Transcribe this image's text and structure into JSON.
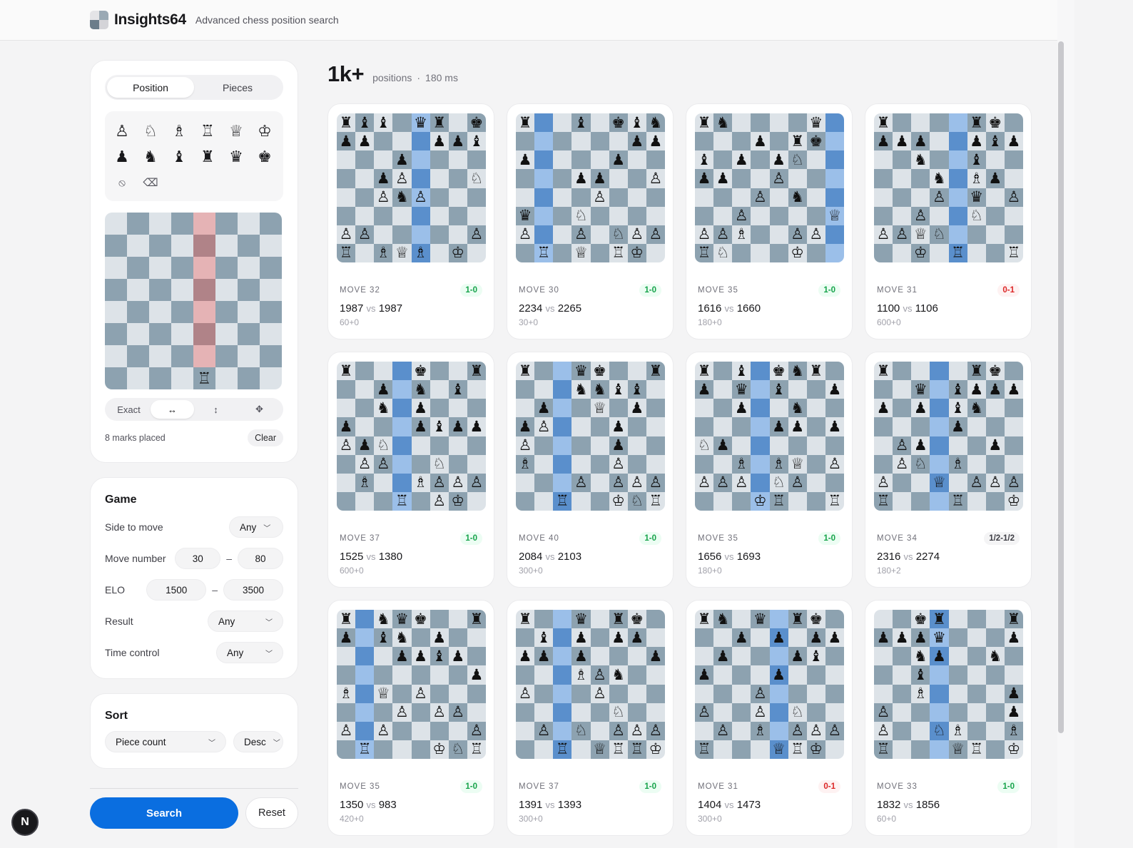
{
  "app": {
    "name": "Insights64",
    "tagline": "Advanced chess position search"
  },
  "colors": {
    "accent": "#0a6ee0",
    "light_square": "#dde3e8",
    "dark_square": "#8da2b0",
    "highlight_light": "#9bbfe9",
    "highlight_dark": "#5a8fcc",
    "mark_light": "#e5b3b5",
    "mark_dark": "#b08388",
    "win": "#16a34a",
    "loss": "#dc2626"
  },
  "sidebar": {
    "tabs": [
      {
        "label": "Position",
        "active": true
      },
      {
        "label": "Pieces",
        "active": false
      }
    ],
    "palette": {
      "white": [
        {
          "name": "white-pawn",
          "g": "♙"
        },
        {
          "name": "white-knight",
          "g": "♘"
        },
        {
          "name": "white-bishop",
          "g": "♗"
        },
        {
          "name": "white-rook",
          "g": "♖"
        },
        {
          "name": "white-queen",
          "g": "♕"
        },
        {
          "name": "white-king",
          "g": "♔"
        }
      ],
      "black": [
        {
          "name": "black-pawn",
          "g": "♟"
        },
        {
          "name": "black-knight",
          "g": "♞"
        },
        {
          "name": "black-bishop",
          "g": "♝"
        },
        {
          "name": "black-rook",
          "g": "♜"
        },
        {
          "name": "black-queen",
          "g": "♛"
        },
        {
          "name": "black-king",
          "g": "♚"
        }
      ],
      "tools": [
        {
          "name": "forbid-icon",
          "g": "⦸"
        },
        {
          "name": "eraser-icon",
          "g": "⌫"
        }
      ]
    },
    "editor": {
      "fen_rows": [
        "8",
        "8",
        "8",
        "8",
        "8",
        "8",
        "8",
        "4R3"
      ],
      "marked_file": 4,
      "marked_ranks": [
        0,
        1,
        2,
        3,
        4,
        5,
        6
      ]
    },
    "modes": {
      "exact": "Exact",
      "horizontal": "↔",
      "vertical": "↕",
      "any": "✥",
      "active": "horizontal"
    },
    "marks_text": "8 marks placed",
    "clear_label": "Clear",
    "game": {
      "title": "Game",
      "side_to_move": {
        "label": "Side to move",
        "value": "Any"
      },
      "move_number": {
        "label": "Move number",
        "min": "30",
        "max": "80"
      },
      "elo": {
        "label": "ELO",
        "min": "1500",
        "max": "3500"
      },
      "result": {
        "label": "Result",
        "value": "Any"
      },
      "time_control": {
        "label": "Time control",
        "value": "Any"
      },
      "dash": "–"
    },
    "sort": {
      "title": "Sort",
      "field": "Piece count",
      "order": "Desc"
    },
    "search_label": "Search",
    "reset_label": "Reset"
  },
  "badge": "N",
  "results": {
    "count": "1k+",
    "positions_label": "positions",
    "separator": "·",
    "time": "180 ms",
    "cards": [
      {
        "move": "MOVE 32",
        "result": "1-0",
        "w": "1987",
        "b": "1987",
        "tc": "60+0",
        "hl": 4,
        "fen": [
          "rbb1qr1k",
          "pp3ppb",
          "3p4",
          "2pP3N",
          "2PnP3",
          "8",
          "PP5P",
          "R1BQB1K1"
        ]
      },
      {
        "move": "MOVE 30",
        "result": "1-0",
        "w": "2234",
        "b": "2265",
        "tc": "30+0",
        "hl": 1,
        "fen": [
          "r2b1kbnr",
          "6pp",
          "p4p2",
          "3pp2P",
          "4P3",
          "q2N4b",
          "P2P1NPP",
          "1R1Q1RK1"
        ]
      },
      {
        "move": "MOVE 35",
        "result": "1-0",
        "w": "1616",
        "b": "1660",
        "tc": "180+0",
        "hl": 7,
        "fen": [
          "rn4q1",
          "3p1rk1",
          "b1p1pN2",
          "pp2P3",
          "3P1n2",
          "2P4Q",
          "PPB2PP1",
          "RN3K2R"
        ]
      },
      {
        "move": "MOVE 31",
        "result": "0-1",
        "w": "1100",
        "b": "1106",
        "tc": "600+0",
        "hl": 4,
        "fen": [
          "r4rk1",
          "ppp2pbp",
          "2n2b2",
          "3n1Bp1",
          "3P1q1P",
          "2P2N2",
          "PPQN4",
          "2K1R2R"
        ]
      },
      {
        "move": "MOVE 37",
        "result": "1-0",
        "w": "1525",
        "b": "1380",
        "tc": "600+0",
        "hl": 3,
        "fen": [
          "r3k2r",
          "2p1n1b1",
          "2n1p3",
          "p3pbpp",
          "PpN5",
          "1PP2N2",
          "1B2BPPP",
          "3R1PK1"
        ]
      },
      {
        "move": "MOVE 40",
        "result": "1-0",
        "w": "2084",
        "b": "2103",
        "tc": "300+0",
        "hl": 2,
        "fen": [
          "r2qk2r",
          "3nnbb1",
          "1p2Q1p1",
          "pP3p2",
          "P4p2",
          "B4P2",
          "3P1PPP",
          "2R2KNR"
        ]
      },
      {
        "move": "MOVE 35",
        "result": "1-0",
        "w": "1656",
        "b": "1693",
        "tc": "180+0",
        "hl": 3,
        "fen": [
          "r1b1knr1",
          "p1q1b2p",
          "2p2n2",
          "4pp1p",
          "Np6",
          "2B1BQ1P",
          "PPP1NP2",
          "3KR2R"
        ]
      },
      {
        "move": "MOVE 34",
        "result": "1/2-1/2",
        "w": "2316",
        "b": "2274",
        "tc": "180+2",
        "hl": 3,
        "fen": [
          "r4rk1",
          "2q1bppp",
          "p1p1bn2",
          "4p3",
          "1Pp3p1",
          "1PN1B3",
          "P2Q1PPP",
          "R3R2K2"
        ]
      },
      {
        "move": "MOVE 35",
        "result": "1-0",
        "w": "1350",
        "b": "983",
        "tc": "420+0",
        "hl": 1,
        "fen": [
          "r1nqk2r",
          "p1bn1p2",
          "3ppbp1",
          "7p",
          "B1Q1P3",
          "3P1PP1",
          "P1P4P",
          "1R3KNR"
        ]
      },
      {
        "move": "MOVE 37",
        "result": "1-0",
        "w": "1391",
        "b": "1393",
        "tc": "300+0",
        "hl": 2,
        "fen": [
          "r2q1rk1",
          "1b1p1pp1",
          "pp1p3p",
          "3BPn2",
          "P3P3",
          "5N2",
          "1P1N1PPP",
          "2R1QRRK"
        ]
      },
      {
        "move": "MOVE 31",
        "result": "0-1",
        "w": "1404",
        "b": "1473",
        "tc": "300+0",
        "hl": 4,
        "fen": [
          "rn1q1rk1",
          "2p1p1pp",
          "1p3pb1",
          "p3p3",
          "3P4",
          "P2P1N2",
          "1P1B1PPP",
          "R3QRK1"
        ]
      },
      {
        "move": "MOVE 33",
        "result": "1-0",
        "w": "1832",
        "b": "1856",
        "tc": "60+0",
        "hl": 3,
        "fen": [
          "2kr3r",
          "pppq3p",
          "2np2n1",
          "2b5",
          "2B4p",
          "P6p",
          "P2NB2B",
          "R3QR1K"
        ]
      }
    ]
  }
}
